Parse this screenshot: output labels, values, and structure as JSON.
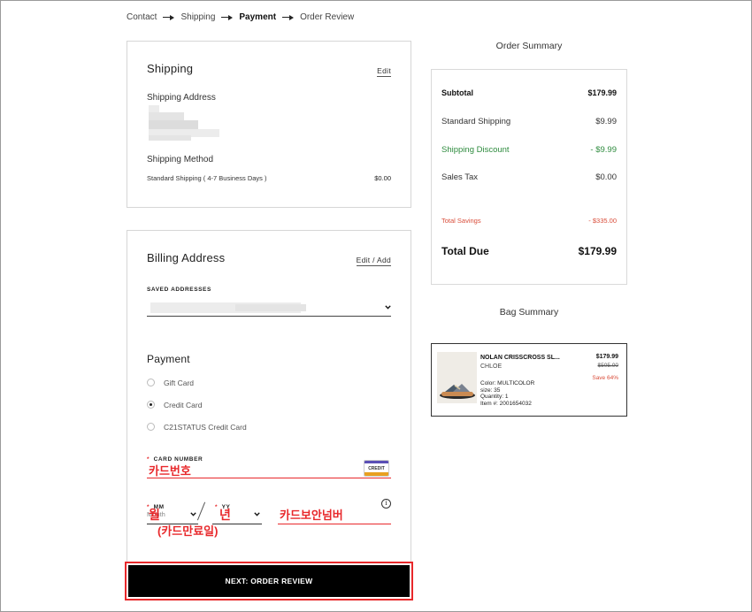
{
  "breadcrumb": {
    "steps": [
      "Contact",
      "Shipping",
      "Payment",
      "Order Review"
    ],
    "active_index": 2
  },
  "shipping": {
    "title": "Shipping",
    "edit_label": "Edit",
    "address_label": "Shipping Address",
    "method_label": "Shipping Method",
    "method_value": "Standard Shipping ( 4-7 Business Days )",
    "method_price": "$0.00"
  },
  "billing": {
    "title": "Billing Address",
    "edit_label": "Edit / Add",
    "saved_label": "SAVED ADDRESSES"
  },
  "payment": {
    "title": "Payment",
    "options": [
      {
        "label": "Gift Card",
        "selected": false
      },
      {
        "label": "Credit Card",
        "selected": true
      },
      {
        "label": "C21STATUS Credit Card",
        "selected": false
      }
    ],
    "card_number_label": "CARD NUMBER",
    "required_mark": "*",
    "card_badge": "CREDIT",
    "card_number_annotation": "카드번호",
    "mm_label": "MM",
    "yy_label": "YY",
    "month_placeholder": "Month",
    "month_annotation": "월",
    "year_annotation": "년",
    "expiry_annotation": "(카드만료일)",
    "cvv_annotation": "카드보안넘버",
    "info_icon": "i",
    "slash": "/"
  },
  "actions": {
    "next_label": "NEXT: ORDER REVIEW"
  },
  "order_summary": {
    "title": "Order Summary",
    "subtotal_label": "Subtotal",
    "subtotal_value": "$179.99",
    "shipping_label": "Standard Shipping",
    "shipping_value": "$9.99",
    "discount_label": "Shipping Discount",
    "discount_value": "- $9.99",
    "tax_label": "Sales Tax",
    "tax_value": "$0.00",
    "savings_label": "Total Savings",
    "savings_value": "- $335.00",
    "total_label": "Total Due",
    "total_value": "$179.99"
  },
  "bag_summary": {
    "title": "Bag Summary",
    "item": {
      "name": "NOLAN CRISSCROSS SL...",
      "brand": "CHLOE",
      "price": "$179.99",
      "original_price": "$505.00",
      "save": "Save 64%",
      "color": "Color: MULTICOLOR",
      "size": "size: 35",
      "quantity": "Quantity: 1",
      "item_number": "Item #: 2001654032"
    }
  },
  "colors": {
    "annotation_red": "#e8282b",
    "discount_green": "#2e8b3e",
    "savings_red": "#d94d3a",
    "button_black": "#000000"
  }
}
